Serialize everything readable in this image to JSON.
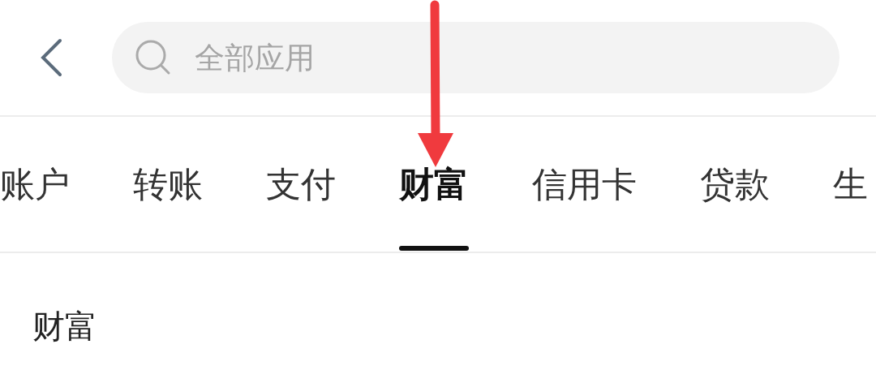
{
  "search": {
    "placeholder": "全部应用"
  },
  "tabs": [
    {
      "label": "账户",
      "selected": false
    },
    {
      "label": "转账",
      "selected": false
    },
    {
      "label": "支付",
      "selected": false
    },
    {
      "label": "财富",
      "selected": true
    },
    {
      "label": "信用卡",
      "selected": false
    },
    {
      "label": "贷款",
      "selected": false
    },
    {
      "label": "生",
      "selected": false
    }
  ],
  "section": {
    "title": "财富"
  }
}
